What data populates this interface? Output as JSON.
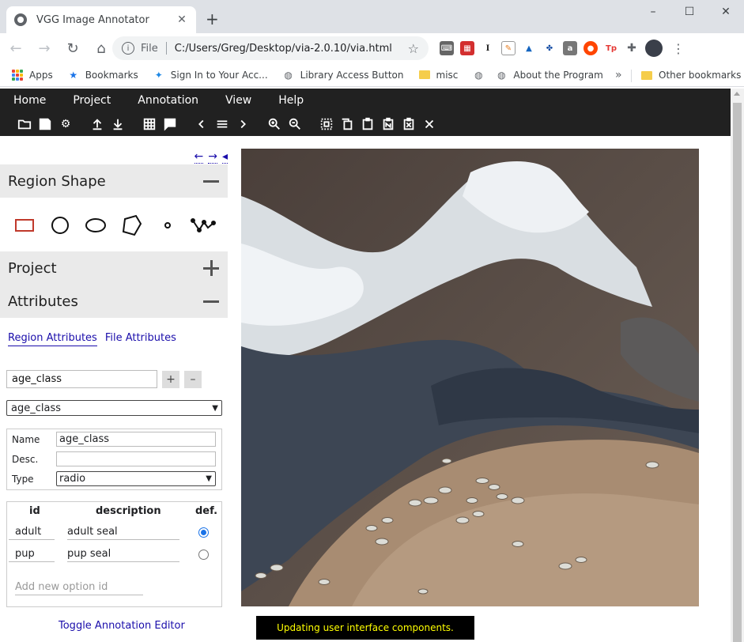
{
  "browser": {
    "tab_title": "VGG Image Annotator",
    "tab_close": "✕",
    "new_tab": "+",
    "window_controls": {
      "minimize": "–",
      "maximize": "☐",
      "close": "✕"
    },
    "nav": {
      "back": "←",
      "forward": "→",
      "reload": "↻",
      "home": "⌂"
    },
    "omnibox": {
      "scheme": "File",
      "url": "C:/Users/Greg/Desktop/via-2.0.10/via.html"
    },
    "bookmarks": [
      {
        "label": "Apps",
        "icon": "apps-grid-icon"
      },
      {
        "label": "Bookmarks",
        "icon": "star-icon"
      },
      {
        "label": "Sign In to Your Acc...",
        "icon": "signin-icon"
      },
      {
        "label": "Library Access Button",
        "icon": "globe-icon"
      },
      {
        "label": "misc",
        "icon": "folder-icon"
      },
      {
        "label": "",
        "icon": "globe-icon"
      },
      {
        "label": "About the Program",
        "icon": "globe-icon"
      }
    ],
    "bookmarks_more": "»",
    "other_bookmarks": "Other bookmarks"
  },
  "via": {
    "menu": [
      "Home",
      "Project",
      "Annotation",
      "View",
      "Help"
    ],
    "panels": {
      "region_shape": "Region Shape",
      "project": "Project",
      "attributes": "Attributes"
    },
    "nav_arrows": {
      "left": "←",
      "right": "→",
      "collapse": "◂"
    },
    "attr_tabs": {
      "region": "Region Attributes",
      "file": "File Attributes"
    },
    "new_attr_value": "age_class",
    "add_btn": "+",
    "remove_btn": "–",
    "attr_select_value": "age_class",
    "attr_props": {
      "name_label": "Name",
      "name_value": "age_class",
      "desc_label": "Desc.",
      "desc_value": "",
      "type_label": "Type",
      "type_value": "radio"
    },
    "options": {
      "headers": {
        "id": "id",
        "description": "description",
        "default": "def."
      },
      "rows": [
        {
          "id": "adult",
          "description": "adult seal",
          "default": true
        },
        {
          "id": "pup",
          "description": "pup seal",
          "default": false
        }
      ],
      "add_placeholder": "Add new option id"
    },
    "toggle_editor": "Toggle Annotation Editor",
    "status": "Updating user interface components."
  }
}
